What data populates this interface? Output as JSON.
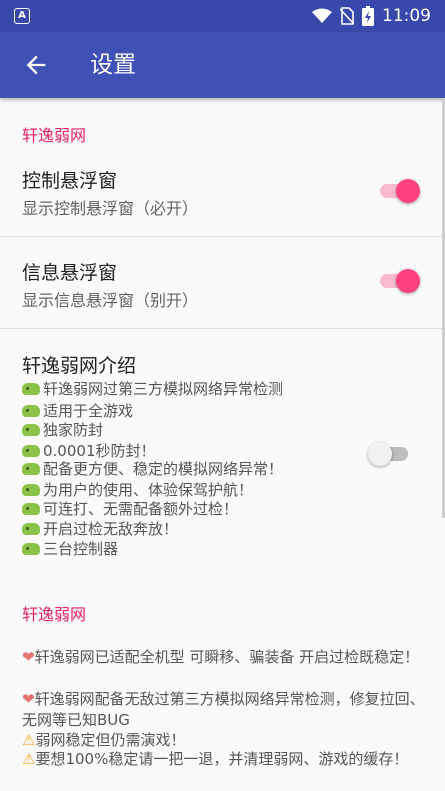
{
  "status_bar": {
    "time": "11:09",
    "left_icon": "A",
    "icons": [
      "wifi-icon",
      "no-sim-icon",
      "battery-charging-icon"
    ]
  },
  "app_bar": {
    "back_icon": "arrow-back-icon",
    "title": "设置"
  },
  "colors": {
    "primary": "#3f51b5",
    "status_bar": "#3949ab",
    "accent": "#ff4081",
    "category": "#e91e63"
  },
  "section1": {
    "category": "轩逸弱网",
    "prefs": [
      {
        "title": "控制悬浮窗",
        "summary": "显示控制悬浮窗（必开）",
        "checked": true
      },
      {
        "title": "信息悬浮窗",
        "summary": "显示信息悬浮窗（别开）",
        "checked": true
      }
    ]
  },
  "intro": {
    "title": "轩逸弱网介绍",
    "checked": false,
    "icon": "gamepad-icon",
    "lines": [
      "轩逸弱网过第三方模拟网络异常检测",
      "适用于全游戏",
      "独家防封",
      "0.0001秒防封！",
      "配备更方便、稳定的模拟网络异常！",
      "为用户的使用、体验保驾护航！",
      "可连打、无需配备额外过检！",
      "开启过检无敌奔放！",
      "三台控制器"
    ]
  },
  "section2": {
    "category": "轩逸弱网",
    "notices": [
      {
        "icon": "heart-icon",
        "symbol": "❤",
        "text": "轩逸弱网已适配全机型 可瞬移、骗装备 开启过检既稳定！"
      },
      {
        "icon": "heart-icon",
        "symbol": "❤",
        "text": "轩逸弱网配备无敌过第三方模拟网络异常检测，修复拉回、无网等已知BUG"
      },
      {
        "icon": "warning-icon",
        "symbol": "⚠",
        "text": "弱网稳定但仍需演戏！"
      },
      {
        "icon": "warning-icon",
        "symbol": "⚠",
        "text": "要想100%稳定请一把一退，并清理弱网、游戏的缓存！"
      }
    ]
  }
}
